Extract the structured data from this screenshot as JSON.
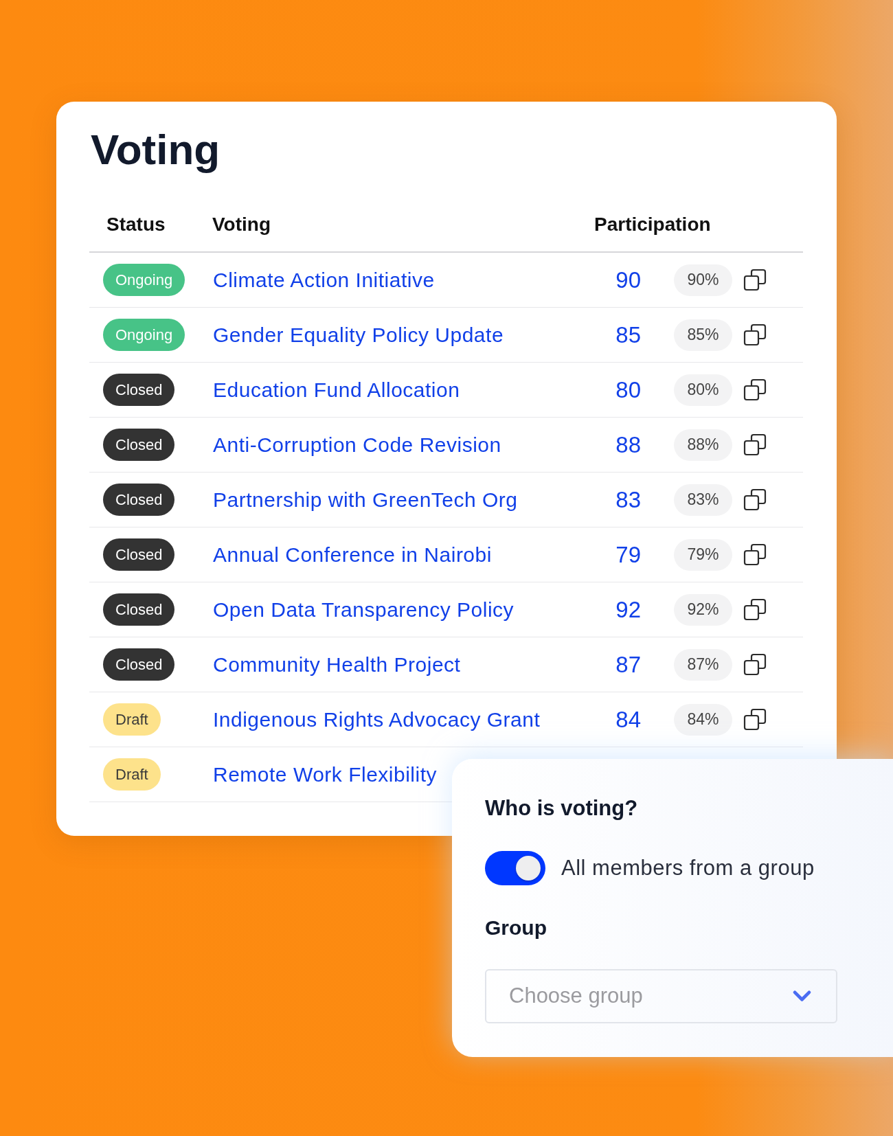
{
  "title": "Voting",
  "table": {
    "columns": [
      "Status",
      "Voting",
      "Participation"
    ],
    "rows": [
      {
        "status": {
          "label": "Ongoing",
          "kind": "ongoing"
        },
        "voting": "Climate Action Initiative",
        "participation": "90",
        "percent": "90%"
      },
      {
        "status": {
          "label": "Ongoing",
          "kind": "ongoing"
        },
        "voting": "Gender Equality Policy Update",
        "participation": "85",
        "percent": "85%"
      },
      {
        "status": {
          "label": "Closed",
          "kind": "closed"
        },
        "voting": "Education Fund Allocation",
        "participation": "80",
        "percent": "80%"
      },
      {
        "status": {
          "label": "Closed",
          "kind": "closed"
        },
        "voting": "Anti-Corruption Code Revision",
        "participation": "88",
        "percent": "88%"
      },
      {
        "status": {
          "label": "Closed",
          "kind": "closed"
        },
        "voting": "Partnership with GreenTech Org",
        "participation": "83",
        "percent": "83%"
      },
      {
        "status": {
          "label": "Closed",
          "kind": "closed"
        },
        "voting": "Annual Conference in Nairobi",
        "participation": "79",
        "percent": "79%"
      },
      {
        "status": {
          "label": "Closed",
          "kind": "closed"
        },
        "voting": "Open Data Transparency Policy",
        "participation": "92",
        "percent": "92%"
      },
      {
        "status": {
          "label": "Closed",
          "kind": "closed"
        },
        "voting": "Community Health Project",
        "participation": "87",
        "percent": "87%"
      },
      {
        "status": {
          "label": "Draft",
          "kind": "draft"
        },
        "voting": "Indigenous Rights Advocacy Grant",
        "participation": "84",
        "percent": "84%"
      },
      {
        "status": {
          "label": "Draft",
          "kind": "draft"
        },
        "voting": "Remote Work Flexibility"
      }
    ]
  },
  "voters_panel": {
    "title": "Who is voting?",
    "toggle": {
      "label": "All members from a group",
      "on": true
    },
    "group_label": "Group",
    "group_select": {
      "placeholder": "Choose group"
    }
  }
}
